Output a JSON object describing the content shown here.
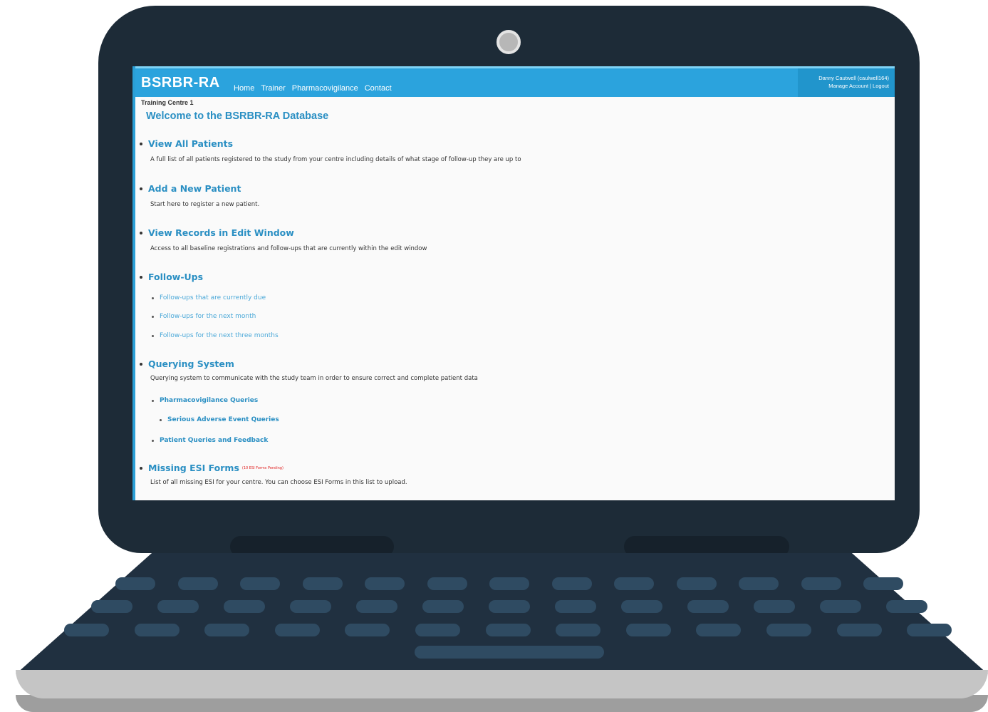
{
  "app": {
    "brand": "BSRBR-RA",
    "nav": [
      "Home",
      "Trainer",
      "Pharmacovigilance",
      "Contact"
    ],
    "account": {
      "user": "Danny Cautwell (caulwell164)",
      "manage": "Manage Account",
      "separator": "|",
      "logout": "Logout"
    },
    "centre": "Training Centre 1",
    "welcome": "Welcome to the BSRBR-RA Database",
    "sections": {
      "view_all": {
        "title": "View All Patients",
        "desc": "A full list of all patients registered to the study from your centre including details of what stage of follow-up they are up to"
      },
      "add_new": {
        "title": "Add a New Patient",
        "desc": "Start here to register a new patient."
      },
      "edit_window": {
        "title": "View Records in Edit Window",
        "desc": "Access to all baseline registrations and follow-ups that are currently within the edit window"
      },
      "follow_ups": {
        "title": "Follow-Ups",
        "links": [
          "Follow-ups that are currently due",
          "Follow-ups for the next month",
          "Follow-ups for the next three months"
        ]
      },
      "querying": {
        "title": "Querying System",
        "desc": "Querying system to communicate with the study team in order to ensure correct and complete patient data",
        "links": {
          "pharma": "Pharmacovigilance Queries",
          "sae": "Serious Adverse Event Queries",
          "patient": "Patient Queries and Feedback"
        }
      },
      "missing_esi": {
        "title": "Missing ESI Forms",
        "pending": "(10 ESI Forms Pending)",
        "desc": "List of all missing ESI for your centre. You can choose ESI Forms in this list to upload."
      }
    }
  },
  "colors": {
    "topbar": "#2ba3dd",
    "heading": "#2a8fc3",
    "laptop": "#1d2b37",
    "keys": "#2f4b62"
  }
}
